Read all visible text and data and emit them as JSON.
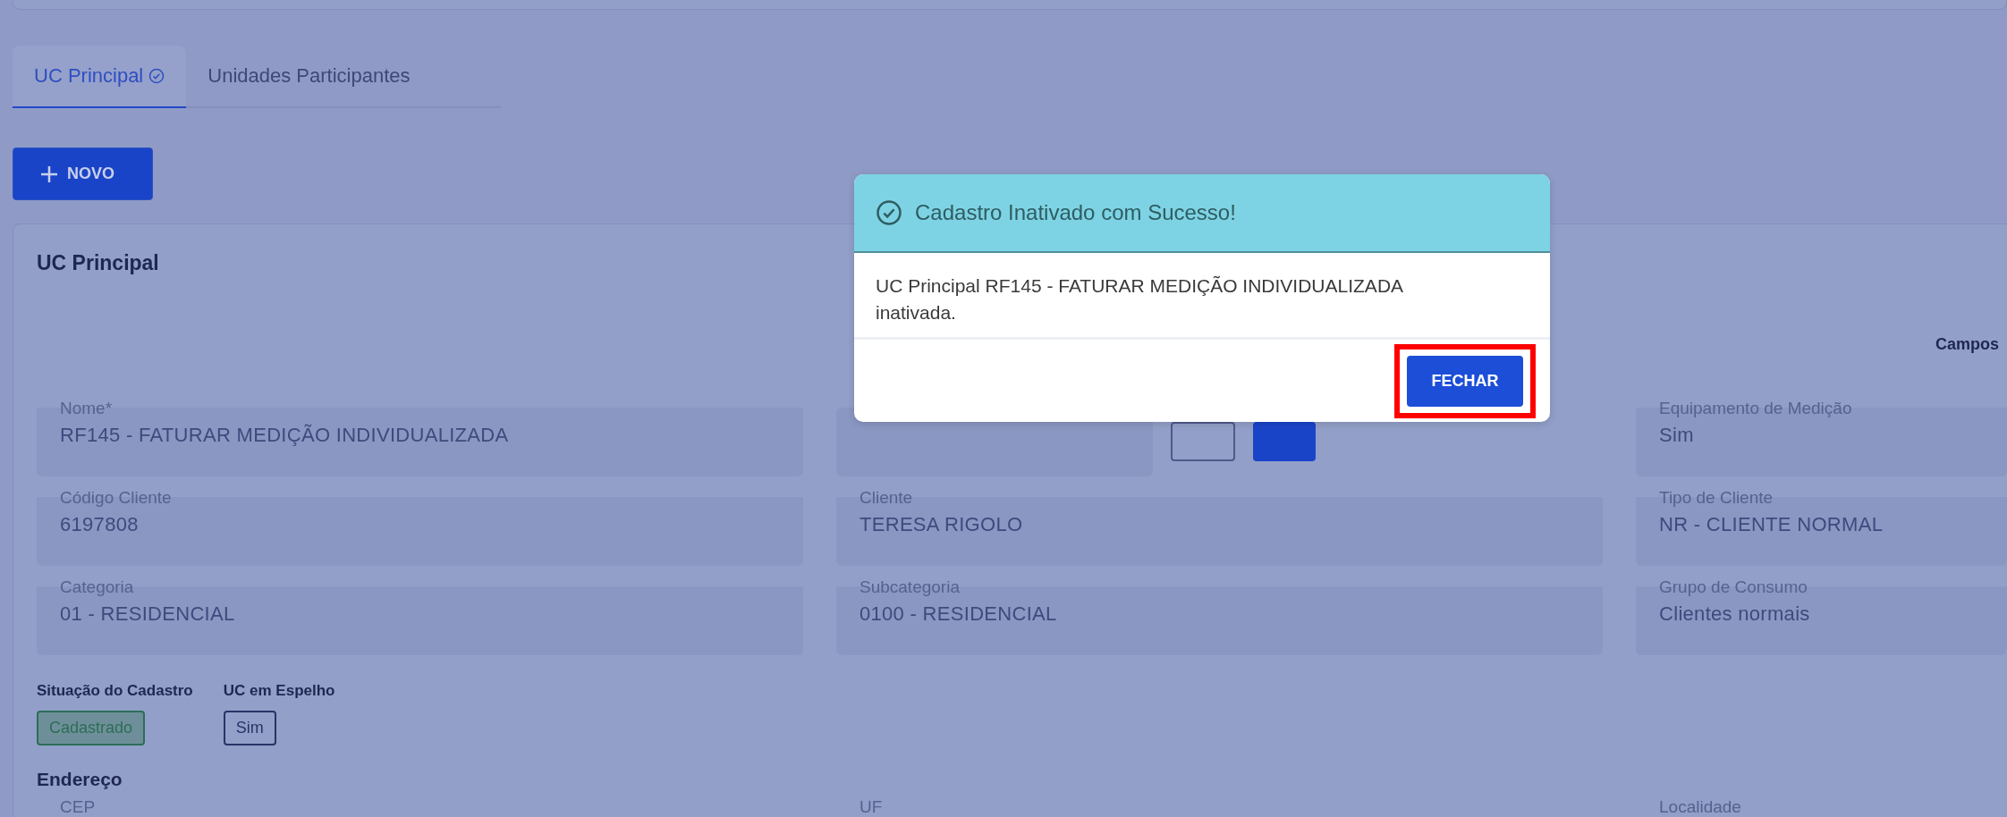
{
  "tabs": [
    {
      "label": "UC Principal",
      "selected": true,
      "verified": true
    },
    {
      "label": "Unidades Participantes",
      "selected": false,
      "verified": false
    }
  ],
  "new_button": {
    "label": "NOVO"
  },
  "card": {
    "title": "UC Principal",
    "note": "Campos",
    "fields": [
      {
        "kind": "text",
        "label": "Nome*",
        "value": "RF145 - FATURAR MEDIÇÃO INDIVIDUALIZADA"
      },
      {
        "kind": "covered"
      },
      {
        "kind": "text",
        "label": "Equipamento de Medição",
        "value": "Sim"
      },
      {
        "kind": "text",
        "label": "Código Cliente",
        "value": "6197808"
      },
      {
        "kind": "text",
        "label": "Cliente",
        "value": "TERESA RIGOLO"
      },
      {
        "kind": "text",
        "label": "Tipo de Cliente",
        "value": "NR - CLIENTE NORMAL"
      },
      {
        "kind": "text",
        "label": "Categoria",
        "value": "01 - RESIDENCIAL"
      },
      {
        "kind": "text",
        "label": "Subcategoria",
        "value": "0100 - RESIDENCIAL"
      },
      {
        "kind": "text",
        "label": "Grupo de Consumo",
        "value": "Clientes normais"
      }
    ],
    "statuses": [
      {
        "label": "Situação do Cadastro",
        "value": "Cadastrado",
        "kind": "success"
      },
      {
        "label": "UC em Espelho",
        "value": "Sim",
        "kind": "neutral"
      }
    ],
    "address": {
      "title": "Endereço",
      "fields": [
        "CEP",
        "UF",
        "Localidade"
      ]
    }
  },
  "dialog": {
    "title": "Cadastro Inativado com Sucesso!",
    "message": "UC Principal RF145 - FATURAR MEDIÇÃO INDIVIDUALIZADA inativada.",
    "button": "FECHAR",
    "highlighted": true
  }
}
